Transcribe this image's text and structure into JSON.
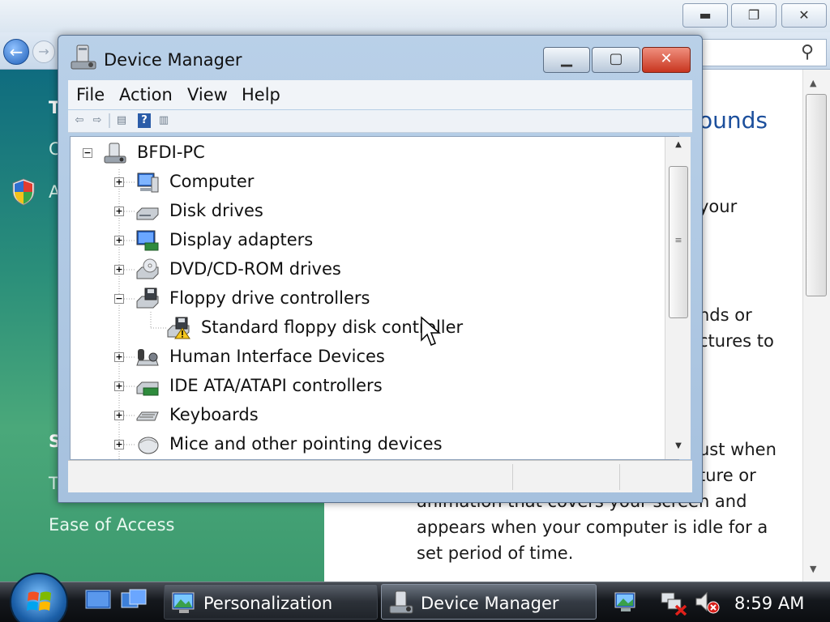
{
  "background_window": {
    "sidebar_fragments": [
      "T",
      "C",
      "A",
      "S",
      "T"
    ],
    "ease_of_access": "Ease of Access",
    "heading_fragment": "ounds",
    "text_fragments": [
      "your",
      "nds or",
      "ctures to",
      "ust when",
      "ture or",
      "animation that covers your screen and",
      "appears when your computer is idle for a",
      "set period of time."
    ]
  },
  "device_manager": {
    "title": "Device Manager",
    "menu": [
      "File",
      "Action",
      "View",
      "Help"
    ],
    "tree": [
      {
        "label": "BFDI-PC",
        "icon": "computer-root-icon",
        "expander": "−"
      },
      {
        "label": "Computer",
        "icon": "computer-icon",
        "expander": "+"
      },
      {
        "label": "Disk drives",
        "icon": "disk-drive-icon",
        "expander": "+"
      },
      {
        "label": "Display adapters",
        "icon": "display-adapter-icon",
        "expander": "+"
      },
      {
        "label": "DVD/CD-ROM drives",
        "icon": "dvd-drive-icon",
        "expander": "+"
      },
      {
        "label": "Floppy drive controllers",
        "icon": "floppy-controller-icon",
        "expander": "−"
      },
      {
        "label": "Standard floppy disk controller",
        "icon": "floppy-warning-icon",
        "expander": ""
      },
      {
        "label": "Human Interface Devices",
        "icon": "hid-icon",
        "expander": "+"
      },
      {
        "label": "IDE ATA/ATAPI controllers",
        "icon": "ide-controller-icon",
        "expander": "+"
      },
      {
        "label": "Keyboards",
        "icon": "keyboard-icon",
        "expander": "+"
      },
      {
        "label": "Mice and other pointing devices",
        "icon": "mouse-icon",
        "expander": "+"
      }
    ]
  },
  "taskbar": {
    "tasks": [
      "Personalization",
      "Device Manager"
    ],
    "clock": "8:59 AM"
  },
  "colors": {
    "accent_blue": "#1c4f9c",
    "close_red": "#c8351f",
    "sidebar_green": "#2b8f7a"
  }
}
